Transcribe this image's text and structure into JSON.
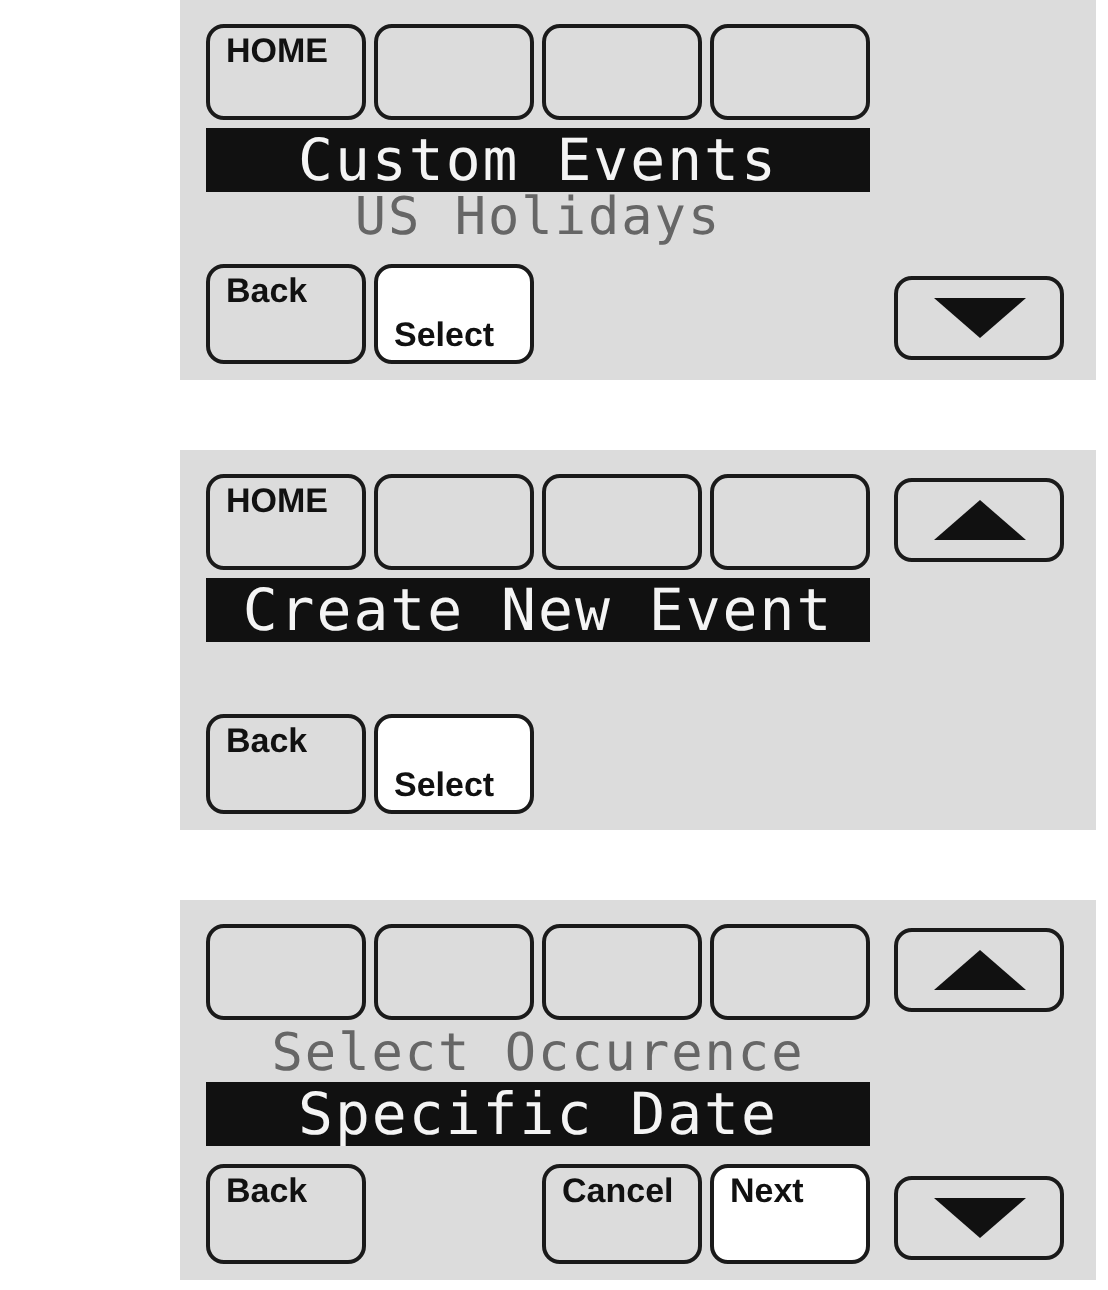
{
  "screens": [
    {
      "top_buttons": [
        {
          "kind": "labeled",
          "label": "HOME"
        },
        {
          "kind": "blank"
        },
        {
          "kind": "blank"
        },
        {
          "kind": "blank"
        }
      ],
      "up_arrow": false,
      "lines": [
        {
          "text": "Custom Events",
          "highlighted": true
        },
        {
          "text": "US Holidays",
          "highlighted": false
        }
      ],
      "bottom_buttons": [
        {
          "kind": "key",
          "label": "Back",
          "selected": false
        },
        {
          "kind": "lowkey",
          "label": "Select",
          "selected": true
        },
        {
          "kind": "empty"
        },
        {
          "kind": "empty"
        }
      ],
      "down_arrow": true
    },
    {
      "top_buttons": [
        {
          "kind": "labeled",
          "label": "HOME"
        },
        {
          "kind": "blank"
        },
        {
          "kind": "blank"
        },
        {
          "kind": "blank"
        }
      ],
      "up_arrow": true,
      "lines": [
        {
          "text": "Create New Event",
          "highlighted": true
        }
      ],
      "bottom_buttons": [
        {
          "kind": "key",
          "label": "Back",
          "selected": false
        },
        {
          "kind": "lowkey",
          "label": "Select",
          "selected": true
        },
        {
          "kind": "empty"
        },
        {
          "kind": "empty"
        }
      ],
      "down_arrow": false
    },
    {
      "top_buttons": [
        {
          "kind": "blank"
        },
        {
          "kind": "blank"
        },
        {
          "kind": "blank"
        },
        {
          "kind": "blank"
        }
      ],
      "up_arrow": true,
      "lines": [
        {
          "text": "Select Occurence",
          "highlighted": false
        },
        {
          "text": "Specific Date",
          "highlighted": true
        }
      ],
      "bottom_buttons": [
        {
          "kind": "key",
          "label": "Back",
          "selected": false
        },
        {
          "kind": "empty"
        },
        {
          "kind": "key",
          "label": "Cancel",
          "selected": false
        },
        {
          "kind": "key",
          "label": "Next",
          "selected": true
        }
      ],
      "down_arrow": true
    }
  ]
}
